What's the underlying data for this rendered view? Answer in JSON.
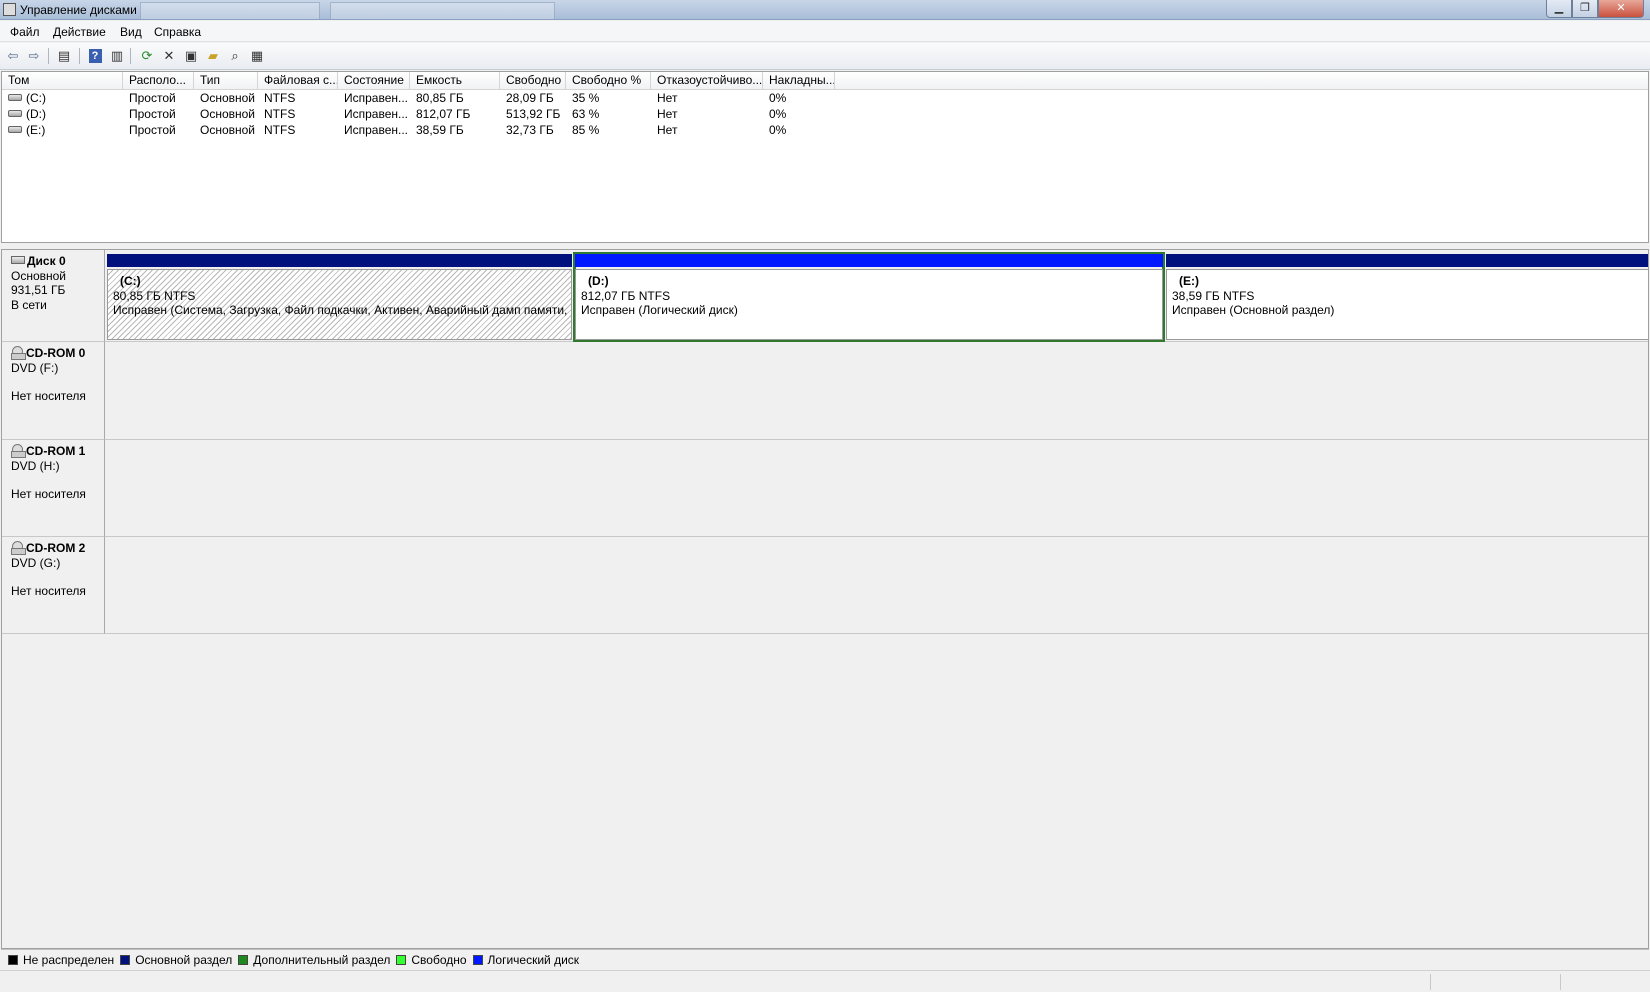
{
  "window": {
    "title": "Управление дисками"
  },
  "menu": [
    {
      "id": "file",
      "label": "Файл"
    },
    {
      "id": "action",
      "label": "Действие"
    },
    {
      "id": "view",
      "label": "Вид"
    },
    {
      "id": "help",
      "label": "Справка"
    }
  ],
  "volume_list": {
    "columns": [
      "Том",
      "Располо...",
      "Тип",
      "Файловая с...",
      "Состояние",
      "Емкость",
      "Свободно",
      "Свободно %",
      "Отказоустойчиво...",
      "Накладны..."
    ],
    "rows": [
      [
        "(C:)",
        "Простой",
        "Основной",
        "NTFS",
        "Исправен...",
        "80,85 ГБ",
        "28,09 ГБ",
        "35 %",
        "Нет",
        "0%"
      ],
      [
        "(D:)",
        "Простой",
        "Основной",
        "NTFS",
        "Исправен...",
        "812,07 ГБ",
        "513,92 ГБ",
        "63 %",
        "Нет",
        "0%"
      ],
      [
        "(E:)",
        "Простой",
        "Основной",
        "NTFS",
        "Исправен...",
        "38,59 ГБ",
        "32,73 ГБ",
        "85 %",
        "Нет",
        "0%"
      ]
    ]
  },
  "disks": {
    "disk0": {
      "name": "Диск 0",
      "type": "Основной",
      "size": "931,51 ГБ",
      "status": "В сети",
      "partitions": [
        {
          "name": "(C:)",
          "size_fs": "80,85 ГБ NTFS",
          "status": "Исправен (Система, Загрузка, Файл подкачки, Активен, Аварийный дамп памяти, Основной раздел)"
        },
        {
          "name": "(D:)",
          "size_fs": "812,07 ГБ NTFS",
          "status": "Исправен (Логический диск)"
        },
        {
          "name": "(E:)",
          "size_fs": "38,59 ГБ NTFS",
          "status": "Исправен (Основной раздел)"
        }
      ]
    },
    "cdrom0": {
      "name": "CD-ROM 0",
      "drive": "DVD (F:)",
      "media": "Нет носителя"
    },
    "cdrom1": {
      "name": "CD-ROM 1",
      "drive": "DVD (H:)",
      "media": "Нет носителя"
    },
    "cdrom2": {
      "name": "CD-ROM 2",
      "drive": "DVD (G:)",
      "media": "Нет носителя"
    }
  },
  "legend": [
    {
      "label": "Не распределен",
      "color": "#000000"
    },
    {
      "label": "Основной раздел",
      "color": "#00107c"
    },
    {
      "label": "Дополнительный раздел",
      "color": "#1e8a1e"
    },
    {
      "label": "Свободно",
      "color": "#33ff33"
    },
    {
      "label": "Логический диск",
      "color": "#0018ff"
    }
  ],
  "colors": {
    "primary_partition": "#00107c",
    "logical_drive": "#0018ff",
    "selection": "#2f7a2f"
  },
  "icons": {
    "back": "arrow-left-icon",
    "forward": "arrow-right-icon",
    "console_tree": "console-tree-icon",
    "help": "help-icon",
    "action_pane": "action-pane-icon",
    "refresh": "refresh-icon",
    "delete": "delete-icon",
    "properties": "properties-icon",
    "open": "open-folder-icon",
    "explore": "explore-icon",
    "settings": "settings-icon"
  }
}
